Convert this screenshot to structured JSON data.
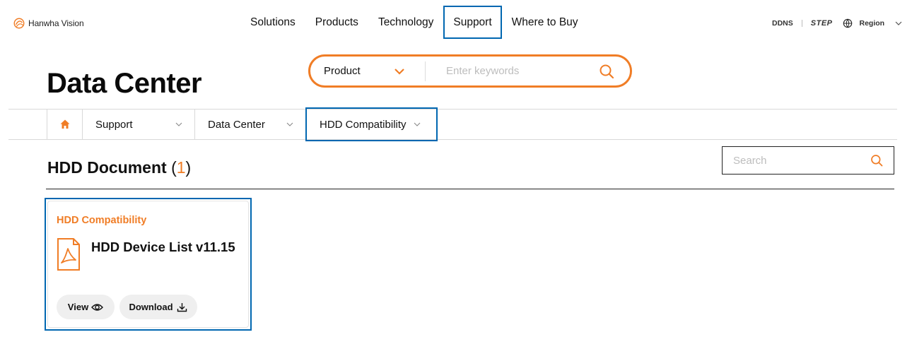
{
  "header": {
    "logo_text": "Hanwha Vision",
    "nav": [
      "Solutions",
      "Products",
      "Technology",
      "Support",
      "Where to Buy"
    ],
    "active_nav_index": 3,
    "utils": {
      "ddns": "DDNS",
      "step": "STEP",
      "region": "Region"
    }
  },
  "page_title": "Data Center",
  "search": {
    "category": "Product",
    "placeholder": "Enter keywords"
  },
  "breadcrumb": {
    "items": [
      "Support",
      "Data Center",
      "HDD Compatibility"
    ]
  },
  "section": {
    "title": "HDD Document",
    "count": "1",
    "search_placeholder": "Search"
  },
  "card": {
    "category": "HDD Compatibility",
    "title": "HDD Device List v11.15",
    "view_label": "View",
    "download_label": "Download"
  },
  "colors": {
    "accent": "#f07d26",
    "highlight": "#0067b1",
    "text": "#111111",
    "divider": "#d9d9d9"
  }
}
